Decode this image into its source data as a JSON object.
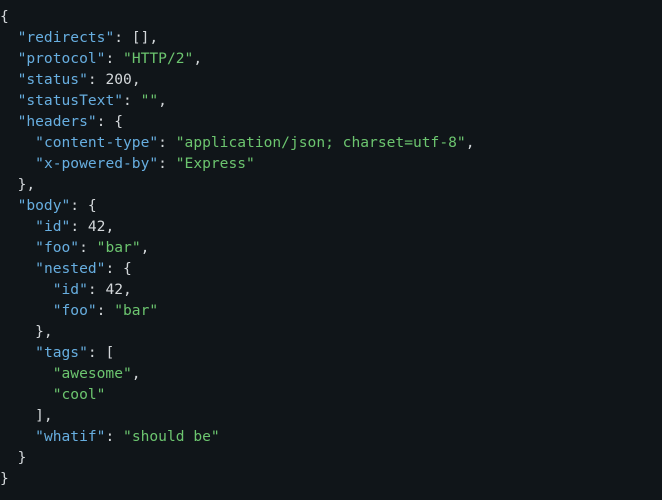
{
  "colors": {
    "background": "#101519",
    "key": "#67aee0",
    "string": "#6cc56f",
    "punctuation": "#d3d7da"
  },
  "lines": [
    [
      {
        "t": "p",
        "v": "{"
      }
    ],
    [
      {
        "t": "p",
        "v": "  "
      },
      {
        "t": "k",
        "v": "\"redirects\""
      },
      {
        "t": "p",
        "v": ": [],"
      }
    ],
    [
      {
        "t": "p",
        "v": "  "
      },
      {
        "t": "k",
        "v": "\"protocol\""
      },
      {
        "t": "p",
        "v": ": "
      },
      {
        "t": "s",
        "v": "\"HTTP/2\""
      },
      {
        "t": "p",
        "v": ","
      }
    ],
    [
      {
        "t": "p",
        "v": "  "
      },
      {
        "t": "k",
        "v": "\"status\""
      },
      {
        "t": "p",
        "v": ": "
      },
      {
        "t": "n",
        "v": "200"
      },
      {
        "t": "p",
        "v": ","
      }
    ],
    [
      {
        "t": "p",
        "v": "  "
      },
      {
        "t": "k",
        "v": "\"statusText\""
      },
      {
        "t": "p",
        "v": ": "
      },
      {
        "t": "s",
        "v": "\"\""
      },
      {
        "t": "p",
        "v": ","
      }
    ],
    [
      {
        "t": "p",
        "v": "  "
      },
      {
        "t": "k",
        "v": "\"headers\""
      },
      {
        "t": "p",
        "v": ": {"
      }
    ],
    [
      {
        "t": "p",
        "v": "    "
      },
      {
        "t": "k",
        "v": "\"content-type\""
      },
      {
        "t": "p",
        "v": ": "
      },
      {
        "t": "s",
        "v": "\"application/json; charset=utf-8\""
      },
      {
        "t": "p",
        "v": ","
      }
    ],
    [
      {
        "t": "p",
        "v": "    "
      },
      {
        "t": "k",
        "v": "\"x-powered-by\""
      },
      {
        "t": "p",
        "v": ": "
      },
      {
        "t": "s",
        "v": "\"Express\""
      }
    ],
    [
      {
        "t": "p",
        "v": "  },"
      }
    ],
    [
      {
        "t": "p",
        "v": "  "
      },
      {
        "t": "k",
        "v": "\"body\""
      },
      {
        "t": "p",
        "v": ": {"
      }
    ],
    [
      {
        "t": "p",
        "v": "    "
      },
      {
        "t": "k",
        "v": "\"id\""
      },
      {
        "t": "p",
        "v": ": "
      },
      {
        "t": "n",
        "v": "42"
      },
      {
        "t": "p",
        "v": ","
      }
    ],
    [
      {
        "t": "p",
        "v": "    "
      },
      {
        "t": "k",
        "v": "\"foo\""
      },
      {
        "t": "p",
        "v": ": "
      },
      {
        "t": "s",
        "v": "\"bar\""
      },
      {
        "t": "p",
        "v": ","
      }
    ],
    [
      {
        "t": "p",
        "v": "    "
      },
      {
        "t": "k",
        "v": "\"nested\""
      },
      {
        "t": "p",
        "v": ": {"
      }
    ],
    [
      {
        "t": "p",
        "v": "      "
      },
      {
        "t": "k",
        "v": "\"id\""
      },
      {
        "t": "p",
        "v": ": "
      },
      {
        "t": "n",
        "v": "42"
      },
      {
        "t": "p",
        "v": ","
      }
    ],
    [
      {
        "t": "p",
        "v": "      "
      },
      {
        "t": "k",
        "v": "\"foo\""
      },
      {
        "t": "p",
        "v": ": "
      },
      {
        "t": "s",
        "v": "\"bar\""
      }
    ],
    [
      {
        "t": "p",
        "v": "    },"
      }
    ],
    [
      {
        "t": "p",
        "v": "    "
      },
      {
        "t": "k",
        "v": "\"tags\""
      },
      {
        "t": "p",
        "v": ": ["
      }
    ],
    [
      {
        "t": "p",
        "v": "      "
      },
      {
        "t": "s",
        "v": "\"awesome\""
      },
      {
        "t": "p",
        "v": ","
      }
    ],
    [
      {
        "t": "p",
        "v": "      "
      },
      {
        "t": "s",
        "v": "\"cool\""
      }
    ],
    [
      {
        "t": "p",
        "v": "    ],"
      }
    ],
    [
      {
        "t": "p",
        "v": "    "
      },
      {
        "t": "k",
        "v": "\"whatif\""
      },
      {
        "t": "p",
        "v": ": "
      },
      {
        "t": "s",
        "v": "\"should be\""
      }
    ],
    [
      {
        "t": "p",
        "v": "  }"
      }
    ],
    [
      {
        "t": "p",
        "v": "}"
      }
    ]
  ]
}
